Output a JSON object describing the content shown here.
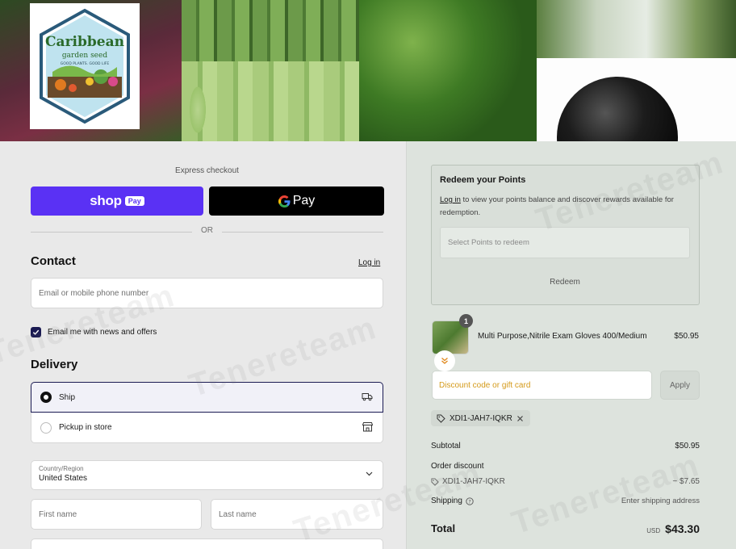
{
  "logo": {
    "brand": "Caribbean",
    "subtitle": "garden seed",
    "tagline": "GOOD PLANTS. GOOD LIFE"
  },
  "checkout": {
    "express_label": "Express checkout",
    "shop_pay_word": "shop",
    "shop_pay_pill": "Pay",
    "gpay_label": "Pay",
    "or_label": "OR"
  },
  "contact": {
    "title": "Contact",
    "login_link": "Log in",
    "email_placeholder": "Email or mobile phone number",
    "newsletter_label": "Email me with news and offers",
    "newsletter_checked": true
  },
  "delivery": {
    "title": "Delivery",
    "options": [
      {
        "label": "Ship",
        "selected": true,
        "icon": "truck-icon"
      },
      {
        "label": "Pickup in store",
        "selected": false,
        "icon": "store-icon"
      }
    ],
    "country_label": "Country/Region",
    "country_value": "United States",
    "first_name_placeholder": "First name",
    "last_name_placeholder": "Last name"
  },
  "redeem": {
    "title": "Redeem your Points",
    "login_link": "Log in",
    "description": " to view your points balance and discover rewards available for redemption.",
    "select_placeholder": "Select Points to redeem",
    "button_label": "Redeem"
  },
  "cart": {
    "item": {
      "name": "Multi Purpose,Nitrile Exam Gloves 400/Medium",
      "price": "$50.95",
      "quantity": "1"
    },
    "discount_placeholder": "Discount code or gift card",
    "apply_label": "Apply",
    "applied_code": "XDI1-JAH7-IQKR"
  },
  "summary": {
    "subtotal_label": "Subtotal",
    "subtotal_value": "$50.95",
    "order_discount_label": "Order discount",
    "discount_code": "XDI1-JAH7-IQKR",
    "discount_value": "− $7.65",
    "shipping_label": "Shipping",
    "shipping_value": "Enter shipping address",
    "total_label": "Total",
    "currency": "USD",
    "total_value": "$43.30"
  },
  "watermark": "Tenereteam",
  "colors": {
    "shop_pay": "#5a31f4",
    "accent_dark": "#1a1a52",
    "discount_text": "#d49a1a"
  }
}
